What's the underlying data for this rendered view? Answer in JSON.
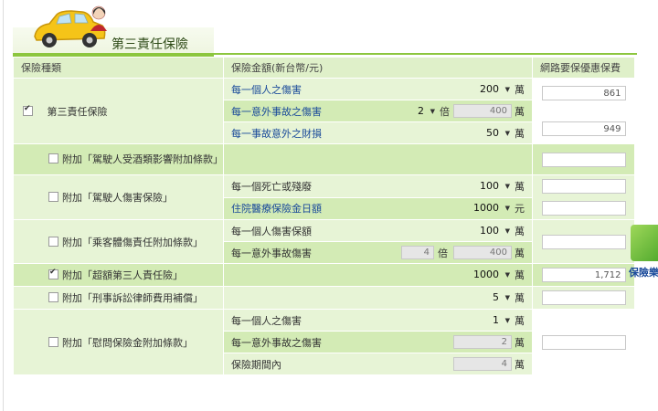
{
  "header": {
    "title": "第三責任保險"
  },
  "table": {
    "col1": "保險種類",
    "col2": "保險金額(新台幣/元)",
    "col3": "網路要保優惠保費"
  },
  "rows": {
    "r1": {
      "name": "第三責任保險",
      "checked": true,
      "s1_label": "每一個人之傷害",
      "s1_value": "200",
      "s1_unit": "萬",
      "s2_label": "每一意外事故之傷害",
      "s2_value": "2",
      "s2_unit": "倍",
      "s2_result": "400",
      "s2_result_unit": "萬",
      "s3_label": "每一事故意外之財損",
      "s3_value": "50",
      "s3_unit": "萬",
      "premium_a": "861",
      "premium_b": "949"
    },
    "r2": {
      "name": "附加「駕駛人受酒類影響附加條款」",
      "checked": false,
      "premium": ""
    },
    "r3": {
      "name": "附加「駕駛人傷害保險」",
      "checked": false,
      "s1_label": "每一個死亡或殘廢",
      "s1_value": "100",
      "s1_unit": "萬",
      "s2_label": "住院醫療保險金日額",
      "s2_value": "1000",
      "s2_unit": "元",
      "premium": ""
    },
    "r4": {
      "name": "附加「乘客體傷責任附加條款」",
      "checked": false,
      "s1_label": "每一個人傷害保額",
      "s1_value": "100",
      "s1_unit": "萬",
      "s2_label": "每一意外事故傷害",
      "s2_mult": "4",
      "s2_unit": "倍",
      "s2_result": "400",
      "s2_result_unit": "萬",
      "premium": ""
    },
    "r5": {
      "name": "附加「超額第三人責任險」",
      "checked": true,
      "value": "1000",
      "unit": "萬",
      "premium": "1,712"
    },
    "r6": {
      "name": "附加「刑事訴訟律師費用補償」",
      "checked": false,
      "value": "5",
      "unit": "萬",
      "premium": ""
    },
    "r7": {
      "name": "附加「慰問保險金附加條款」",
      "checked": false,
      "s1_label": "每一個人之傷害",
      "s1_value": "1",
      "s1_unit": "萬",
      "s2_label": "每一意外事故之傷害",
      "s2_value": "2",
      "s2_unit": "萬",
      "s3_label": "保險期間內",
      "s3_value": "4",
      "s3_unit": "萬",
      "premium": ""
    }
  },
  "float_button": {
    "label": "保險樂"
  },
  "colors": {
    "accent": "#8cc63e",
    "header_bg": "#dff0c9",
    "row_light": "#e7f4d6",
    "row_dark": "#d3ebb5"
  }
}
